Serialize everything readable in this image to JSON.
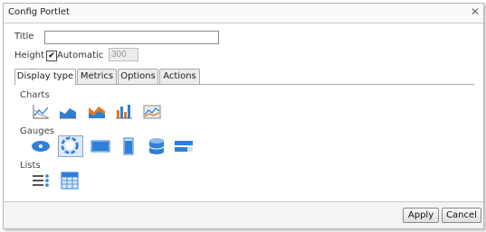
{
  "dialog": {
    "title": "Config Portlet",
    "close_glyph": "✕"
  },
  "form": {
    "title_label": "Title",
    "title_value": "",
    "height_label": "Height",
    "automatic_label": "Automatic",
    "automatic_checked": true,
    "height_value": "300"
  },
  "tabs": [
    {
      "label": "Display type",
      "active": true
    },
    {
      "label": "Metrics",
      "active": false
    },
    {
      "label": "Options",
      "active": false
    },
    {
      "label": "Actions",
      "active": false
    }
  ],
  "sections": {
    "charts": "Charts",
    "gauges": "Gauges",
    "lists": "Lists"
  },
  "icons": {
    "charts": [
      "line-chart-icon",
      "area-chart-icon",
      "stacked-area-chart-icon",
      "bar-chart-icon",
      "multi-line-chart-icon"
    ],
    "gauges": [
      "gauge-oval-icon",
      "gauge-dial-icon",
      "gauge-horizontal-icon",
      "gauge-vertical-icon",
      "gauge-cylinder-icon",
      "gauge-progress-icon"
    ],
    "lists": [
      "list-icon",
      "table-icon"
    ],
    "selected": "gauge-dial-icon"
  },
  "colors": {
    "accent": "#2f7fd8",
    "orange": "#e07b1f"
  },
  "footer": {
    "apply_label": "Apply",
    "cancel_label": "Cancel"
  }
}
